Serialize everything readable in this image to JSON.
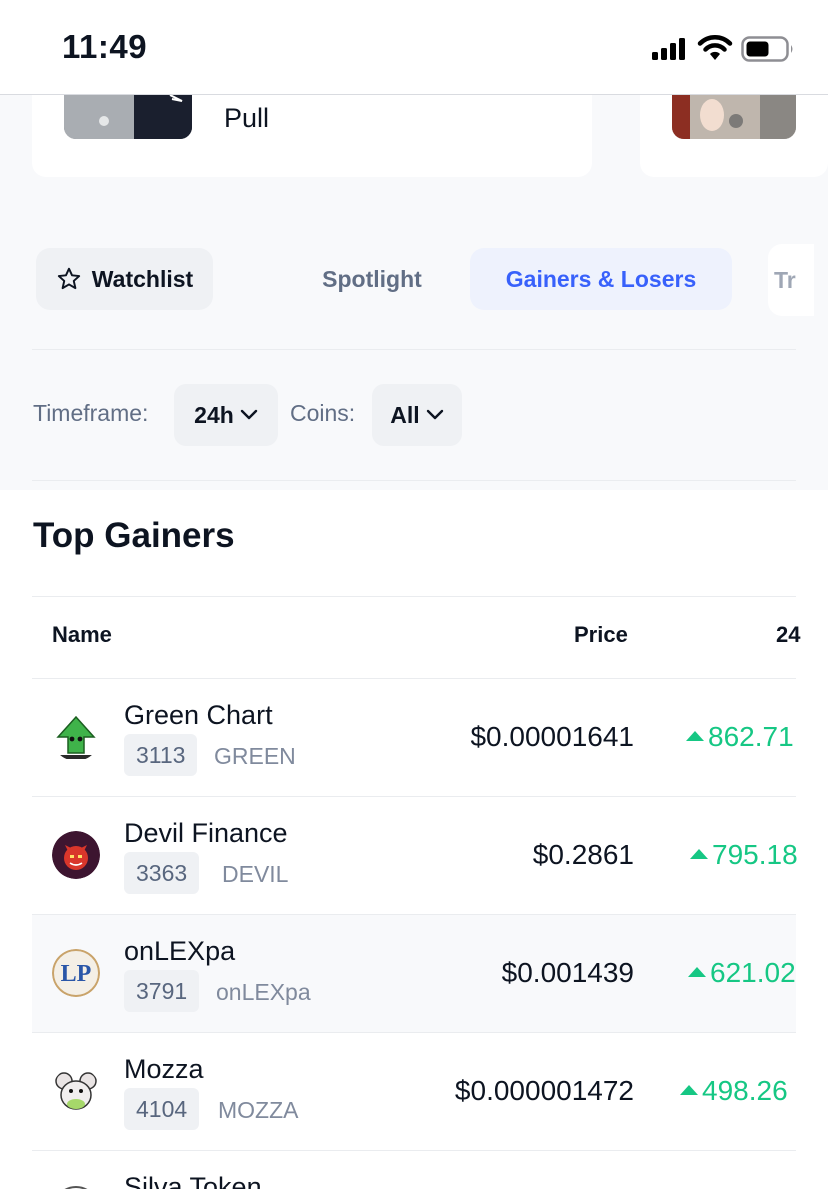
{
  "status_bar": {
    "time": "11:49"
  },
  "news": {
    "title": "Pull"
  },
  "tabs": [
    {
      "label": "Watchlist",
      "icon": "star-icon"
    },
    {
      "label": "Spotlight"
    },
    {
      "label": "Gainers & Losers",
      "active": true
    },
    {
      "label": "Tr"
    }
  ],
  "filters": {
    "timeframe_label": "Timeframe:",
    "timeframe_value": "24h",
    "coins_label": "Coins:",
    "coins_value": "All"
  },
  "section_title": "Top Gainers",
  "table": {
    "headers": {
      "name": "Name",
      "price": "Price",
      "change": "24"
    },
    "rows": [
      {
        "name": "Green Chart",
        "rank": "3113",
        "symbol": "GREEN",
        "price": "$0.00001641",
        "change": "862.71"
      },
      {
        "name": "Devil Finance",
        "rank": "3363",
        "symbol": "DEVIL",
        "price": "$0.2861",
        "change": "795.18"
      },
      {
        "name": "onLEXpa",
        "rank": "3791",
        "symbol": "onLEXpa",
        "price": "$0.001439",
        "change": "621.02"
      },
      {
        "name": "Mozza",
        "rank": "4104",
        "symbol": "MOZZA",
        "price": "$0.000001472",
        "change": "498.26"
      },
      {
        "name": "Silva Token"
      }
    ]
  },
  "colors": {
    "accent": "#3861fb",
    "positive": "#16c784",
    "text": "#0d1421",
    "muted": "#616e85"
  }
}
